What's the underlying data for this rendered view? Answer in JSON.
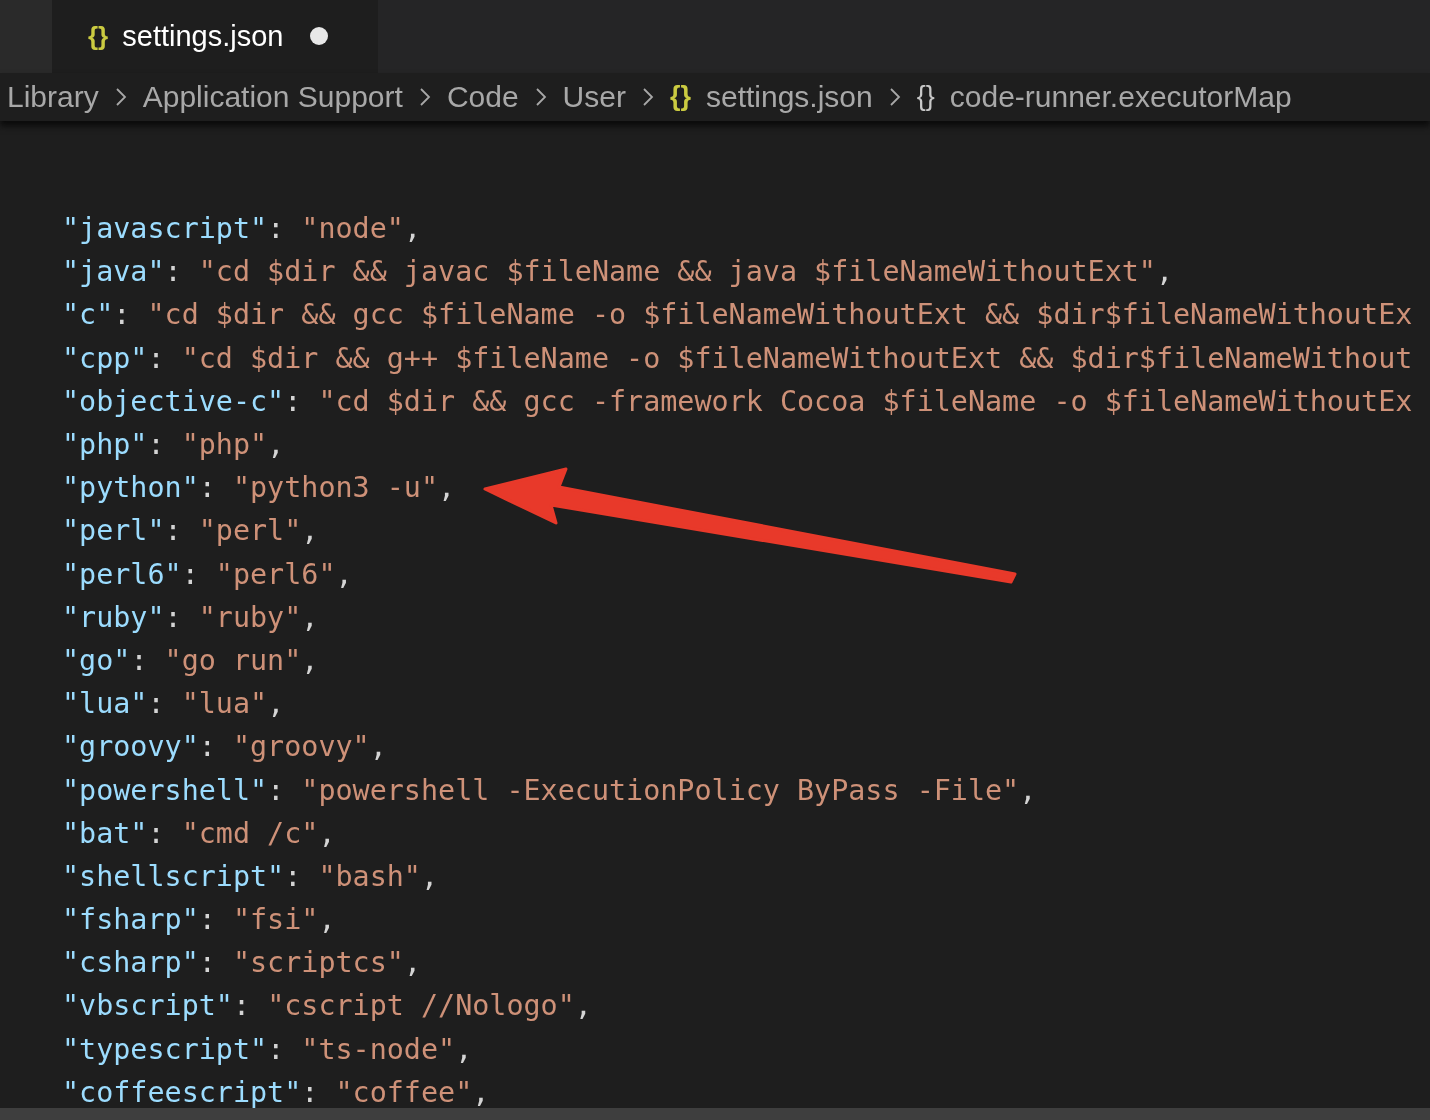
{
  "tabs": [
    {
      "label": "settings.json",
      "icon": "{}",
      "selected": true,
      "modified": true
    }
  ],
  "breadcrumbs": [
    {
      "label": "Library",
      "kind": "folder"
    },
    {
      "label": "Application Support",
      "kind": "folder"
    },
    {
      "label": "Code",
      "kind": "folder"
    },
    {
      "label": "User",
      "kind": "folder"
    },
    {
      "label": "settings.json",
      "icon": "{}",
      "kind": "file"
    },
    {
      "label": "code-runner.executorMap",
      "icon": "{}",
      "kind": "symbol"
    }
  ],
  "editor": {
    "lines": [
      {
        "key": "\"javascript\"",
        "colon": ":",
        "value": "\"node\"",
        "comma": ","
      },
      {
        "key": "\"java\"",
        "colon": ":",
        "value": "\"cd $dir && javac $fileName && java $fileNameWithoutExt\"",
        "comma": ","
      },
      {
        "key": "\"c\"",
        "colon": ":",
        "value": "\"cd $dir && gcc $fileName -o $fileNameWithoutExt && $dir$fileNameWithoutEx"
      },
      {
        "key": "\"cpp\"",
        "colon": ":",
        "value": "\"cd $dir && g++ $fileName -o $fileNameWithoutExt && $dir$fileNameWithout"
      },
      {
        "key": "\"objective-c\"",
        "colon": ":",
        "value": "\"cd $dir && gcc -framework Cocoa $fileName -o $fileNameWithoutEx"
      },
      {
        "key": "\"php\"",
        "colon": ":",
        "value": "\"php\"",
        "comma": ","
      },
      {
        "key": "\"python\"",
        "colon": ":",
        "value": "\"python3 -u\"",
        "comma": ","
      },
      {
        "key": "\"perl\"",
        "colon": ":",
        "value": "\"perl\"",
        "comma": ","
      },
      {
        "key": "\"perl6\"",
        "colon": ":",
        "value": "\"perl6\"",
        "comma": ","
      },
      {
        "key": "\"ruby\"",
        "colon": ":",
        "value": "\"ruby\"",
        "comma": ","
      },
      {
        "key": "\"go\"",
        "colon": ":",
        "value": "\"go run\"",
        "comma": ","
      },
      {
        "key": "\"lua\"",
        "colon": ":",
        "value": "\"lua\"",
        "comma": ","
      },
      {
        "key": "\"groovy\"",
        "colon": ":",
        "value": "\"groovy\"",
        "comma": ","
      },
      {
        "key": "\"powershell\"",
        "colon": ":",
        "value": "\"powershell -ExecutionPolicy ByPass -File\"",
        "comma": ","
      },
      {
        "key": "\"bat\"",
        "colon": ":",
        "value": "\"cmd /c\"",
        "comma": ","
      },
      {
        "key": "\"shellscript\"",
        "colon": ":",
        "value": "\"bash\"",
        "comma": ","
      },
      {
        "key": "\"fsharp\"",
        "colon": ":",
        "value": "\"fsi\"",
        "comma": ","
      },
      {
        "key": "\"csharp\"",
        "colon": ":",
        "value": "\"scriptcs\"",
        "comma": ","
      },
      {
        "key": "\"vbscript\"",
        "colon": ":",
        "value": "\"cscript //Nologo\"",
        "comma": ","
      },
      {
        "key": "\"typescript\"",
        "colon": ":",
        "value": "\"ts-node\"",
        "comma": ","
      },
      {
        "key": "\"coffeescript\"",
        "colon": ":",
        "value": "\"coffee\"",
        "comma": ","
      }
    ]
  }
}
